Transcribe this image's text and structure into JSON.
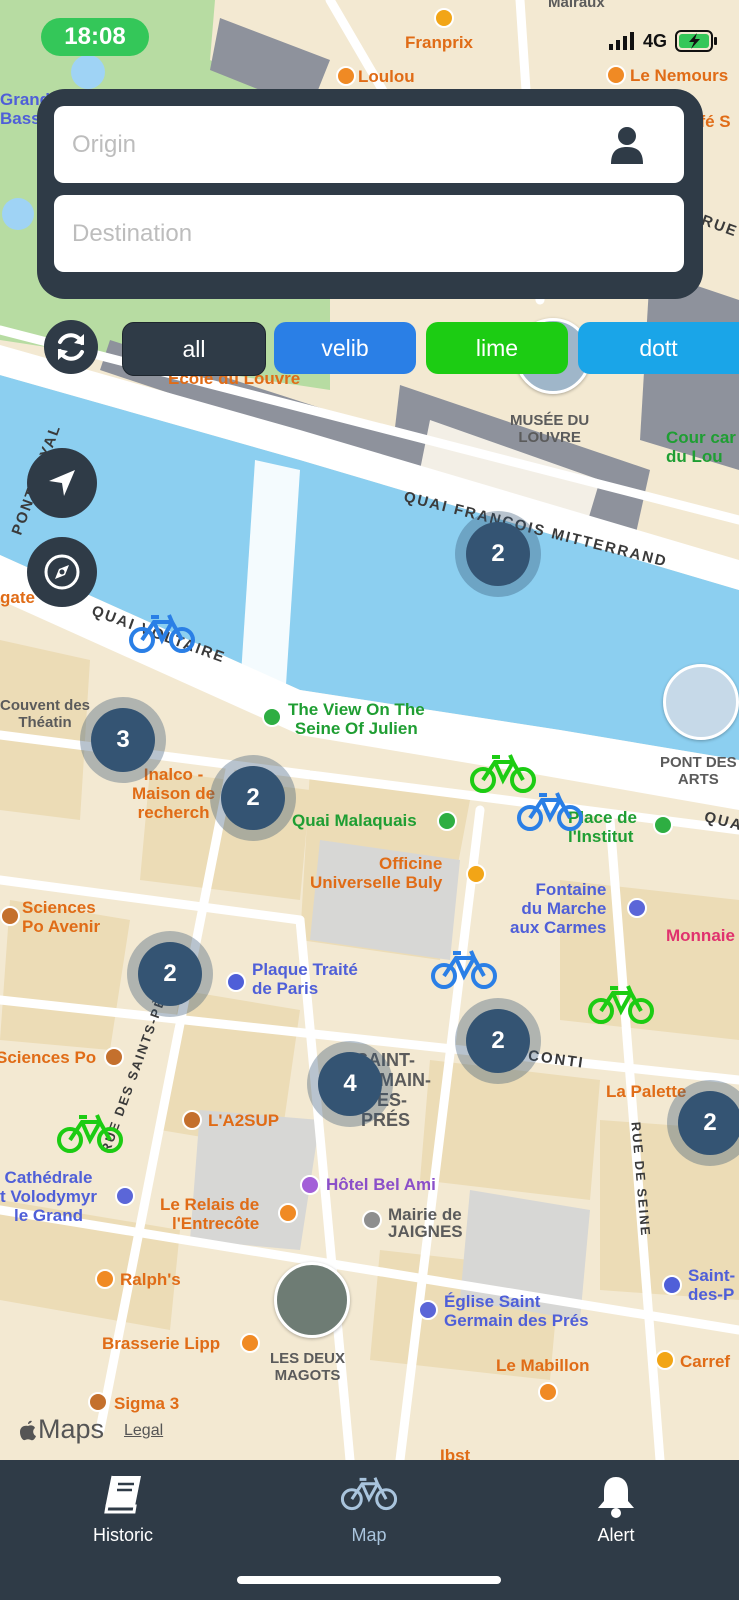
{
  "status_bar": {
    "time": "18:08",
    "network": "4G"
  },
  "search": {
    "origin_placeholder": "Origin",
    "destination_placeholder": "Destination"
  },
  "filters": [
    {
      "label": "all",
      "color": "#2f3b47"
    },
    {
      "label": "velib",
      "color": "#2a7fe6"
    },
    {
      "label": "lime",
      "color": "#1ccc13"
    },
    {
      "label": "dott",
      "color": "#1aa5e8"
    }
  ],
  "map": {
    "labels": {
      "franprix": "Franprix",
      "loulou": "Loulou",
      "le_nemours": "Le Nemours",
      "cafe": "afé S",
      "grand_bassin": "Grand\nBassi",
      "malraux": "Malraux",
      "rue_de": "RUE DE",
      "ecole_du_louvre": "École du Louvre",
      "musee_du_louvre": "MUSÉE DU\nLOUVRE",
      "cour_carree": "Cour car\ndu Lou",
      "pont_royal": "PONT ROYAL",
      "quai_mitterrand": "QUAI FRANÇOIS MITTERRAND",
      "gate": "gate",
      "quai_voltaire": "QUAI VOLTAIRE",
      "couvent": "Couvent des\nThéatin",
      "the_view": "The View On The\nSeine Of Julien",
      "pont_des_arts": "PONT DES\nARTS",
      "inalco": "Inalco -\nMaison de\nrecherch",
      "quai_malaquais": "Quai Malaquais",
      "place_institut": "Place de\nl'Institut",
      "qua": "QUA",
      "officine": "Officine\nUniverselle Buly",
      "fontaine": "Fontaine\ndu Marche\naux Carmes",
      "monnaie": "Monnaie",
      "sciences_po_avenir": "Sciences\nPo Avenir",
      "plaque": "Plaque Traité\nde Paris",
      "sciences_po": "Sciences Po",
      "rue_des_saints_peres": "RUE DES SAINTS-PÈRES",
      "saint_germain": "SAINT-\nGERMAIN-\nDES-\nPRÉS",
      "conti": "CONTI",
      "la_palette": "La Palette",
      "rue_de_seine": "RUE DE SEINE",
      "la2sup": "L'A2SUP",
      "cathedrale": "Cathédrale\nt Volodymyr\nle Grand",
      "hotel_bel_ami": "Hôtel Bel Ami",
      "relais": "Le Relais de\nl'Entrecôte",
      "mairie": "Mairie de\nJAIGNES",
      "ralphs": "Ralph's",
      "saint_des_pres": "Saint-\ndes-P",
      "eglise": "Église Saint\nGermain des Prés",
      "brasserie": "Brasserie Lipp",
      "carrefour": "Carref",
      "deux_magots": "LES DEUX\nMAGOTS",
      "le_mabillon": "Le Mabillon",
      "sigma": "Sigma 3",
      "ibst": "Ibst"
    },
    "clusters": [
      {
        "count": "2"
      },
      {
        "count": "3"
      },
      {
        "count": "2"
      },
      {
        "count": "2"
      },
      {
        "count": "2"
      },
      {
        "count": "4"
      },
      {
        "count": "2"
      }
    ],
    "attribution": {
      "maps": "Maps",
      "legal": "Legal"
    }
  },
  "tabs": [
    {
      "label": "Historic",
      "icon": "book-icon",
      "active": true
    },
    {
      "label": "Map",
      "icon": "bicycle-icon",
      "active": false
    },
    {
      "label": "Alert",
      "icon": "bell-icon",
      "active": true
    }
  ]
}
